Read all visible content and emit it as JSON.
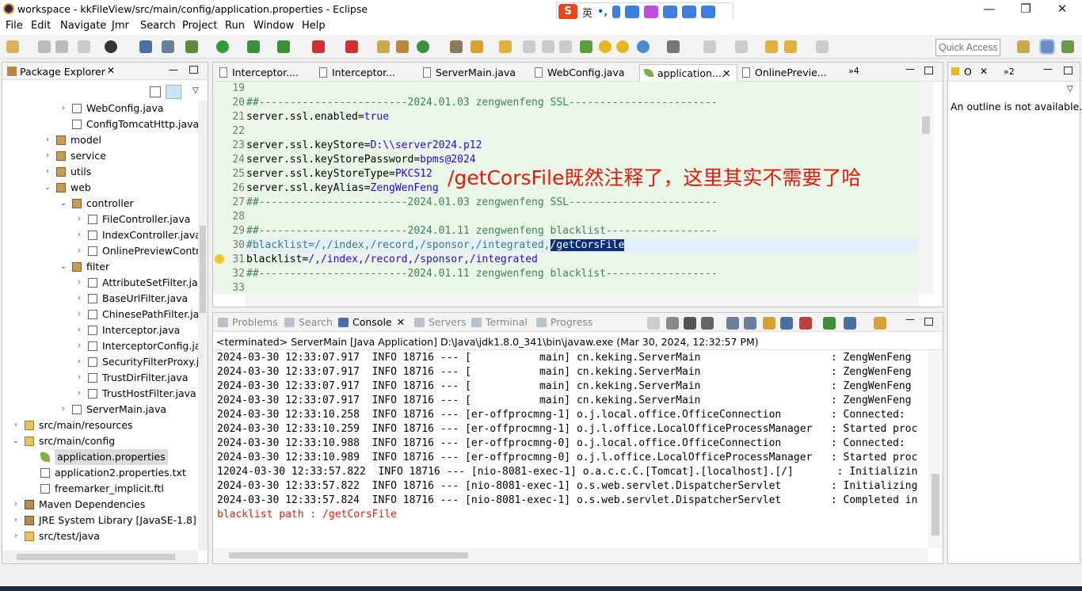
{
  "window": {
    "title": "workspace - kkFileView/src/main/config/application.properties - Eclipse",
    "min": "—",
    "restore": "❐",
    "close": "✕"
  },
  "ime": {
    "lang": "英",
    "punct": "•,",
    "logo": "S"
  },
  "menu": [
    "File",
    "Edit",
    "Navigate",
    "Jmr",
    "Search",
    "Project",
    "Run",
    "Window",
    "Help"
  ],
  "quick_access": {
    "placeholder": "Quick Access"
  },
  "package_explorer": {
    "title": "Package Explorer",
    "items": [
      {
        "label": "WebConfig.java",
        "depth": 4,
        "icon": "file",
        "tw": "›"
      },
      {
        "label": "ConfigTomcatHttp.java",
        "depth": 4,
        "icon": "file",
        "tw": ""
      },
      {
        "label": "model",
        "depth": 3,
        "icon": "pkg",
        "tw": "›"
      },
      {
        "label": "service",
        "depth": 3,
        "icon": "pkg",
        "tw": "›"
      },
      {
        "label": "utils",
        "depth": 3,
        "icon": "pkg",
        "tw": "›"
      },
      {
        "label": "web",
        "depth": 3,
        "icon": "pkg",
        "tw": "⌄"
      },
      {
        "label": "controller",
        "depth": 4,
        "icon": "pkg",
        "tw": "⌄"
      },
      {
        "label": "FileController.java",
        "depth": 5,
        "icon": "file",
        "tw": "›"
      },
      {
        "label": "IndexController.java",
        "depth": 5,
        "icon": "file",
        "tw": "›"
      },
      {
        "label": "OnlinePreviewController.java",
        "depth": 5,
        "icon": "file",
        "tw": "›"
      },
      {
        "label": "filter",
        "depth": 4,
        "icon": "pkg",
        "tw": "⌄"
      },
      {
        "label": "AttributeSetFilter.java",
        "depth": 5,
        "icon": "file",
        "tw": "›"
      },
      {
        "label": "BaseUrlFilter.java",
        "depth": 5,
        "icon": "file",
        "tw": "›"
      },
      {
        "label": "ChinesePathFilter.java",
        "depth": 5,
        "icon": "file",
        "tw": "›"
      },
      {
        "label": "Interceptor.java",
        "depth": 5,
        "icon": "file",
        "tw": "›"
      },
      {
        "label": "InterceptorConfig.java",
        "depth": 5,
        "icon": "file",
        "tw": "›"
      },
      {
        "label": "SecurityFilterProxy.java",
        "depth": 5,
        "icon": "file",
        "tw": "›"
      },
      {
        "label": "TrustDirFilter.java",
        "depth": 5,
        "icon": "file",
        "tw": "›"
      },
      {
        "label": "TrustHostFilter.java",
        "depth": 5,
        "icon": "file",
        "tw": "›"
      },
      {
        "label": "ServerMain.java",
        "depth": 4,
        "icon": "file",
        "tw": "›"
      },
      {
        "label": "src/main/resources",
        "depth": 1,
        "icon": "fold",
        "tw": "›"
      },
      {
        "label": "src/main/config",
        "depth": 1,
        "icon": "fold",
        "tw": "⌄"
      },
      {
        "label": "application.properties",
        "depth": 2,
        "icon": "leaf",
        "tw": "",
        "selected": true
      },
      {
        "label": "application2.properties.txt",
        "depth": 2,
        "icon": "file",
        "tw": ""
      },
      {
        "label": "freemarker_implicit.ftl",
        "depth": 2,
        "icon": "file",
        "tw": ""
      },
      {
        "label": "Maven Dependencies",
        "depth": 1,
        "icon": "jar",
        "tw": "›"
      },
      {
        "label": "JRE System Library [JavaSE-1.8]",
        "depth": 1,
        "icon": "jar",
        "tw": "›"
      },
      {
        "label": "src/test/java",
        "depth": 1,
        "icon": "fold",
        "tw": "›"
      }
    ]
  },
  "editor": {
    "tabs": [
      "Interceptor.java",
      "InterceptorConfig.java",
      "ServerMain.java",
      "WebConfig.java",
      "application.properties",
      "OnlinePreviewController.java"
    ],
    "tab_display": [
      "Interceptor....",
      "Interceptor...",
      "ServerMain.java",
      "WebConfig.java",
      "application....",
      "OnlinePrevie..."
    ],
    "overflow": "»4",
    "lines": [
      {
        "n": "19",
        "parts": []
      },
      {
        "n": "20",
        "parts": [
          {
            "c": "cm",
            "t": "##------------------------2024.01.03 zengwenfeng SSL------------------------"
          }
        ]
      },
      {
        "n": "21",
        "parts": [
          {
            "c": "",
            "t": "server.ssl.enabled="
          },
          {
            "c": "vb",
            "t": "true"
          }
        ]
      },
      {
        "n": "22",
        "parts": []
      },
      {
        "n": "23",
        "parts": [
          {
            "c": "",
            "t": "server.ssl.keyStore="
          },
          {
            "c": "vb",
            "t": "D:\\\\server2024.p12"
          }
        ]
      },
      {
        "n": "24",
        "parts": [
          {
            "c": "",
            "t": "server.ssl.keyStorePassword="
          },
          {
            "c": "vb",
            "t": "bpms@2024"
          }
        ]
      },
      {
        "n": "25",
        "parts": [
          {
            "c": "",
            "t": "server.ssl.keyStoreType="
          },
          {
            "c": "vb",
            "t": "PKCS12"
          }
        ]
      },
      {
        "n": "26",
        "parts": [
          {
            "c": "",
            "t": "server.ssl.keyAlias="
          },
          {
            "c": "vb",
            "t": "ZengWenFeng"
          }
        ]
      },
      {
        "n": "27",
        "parts": [
          {
            "c": "cm",
            "t": "##------------------------2024.01.03 zengwenfeng SSL------------------------"
          }
        ]
      },
      {
        "n": "28",
        "parts": []
      },
      {
        "n": "29",
        "parts": [
          {
            "c": "cm",
            "t": "##------------------------2024.01.11 zengwenfeng blacklist------------------"
          }
        ]
      },
      {
        "n": "30",
        "parts": [
          {
            "c": "cm",
            "t": "#blacklist=/,/index,/record,/sponsor,/integrated,"
          },
          {
            "c": "hl",
            "t": "/getCorsFile"
          }
        ]
      },
      {
        "n": "31",
        "parts": [
          {
            "c": "",
            "t": "blacklist="
          },
          {
            "c": "vb",
            "t": "/,/index,/record,/sponsor,/integrated"
          }
        ]
      },
      {
        "n": "32",
        "parts": [
          {
            "c": "cm",
            "t": "##------------------------2024.01.11 zengwenfeng blacklist------------------"
          }
        ]
      },
      {
        "n": "33",
        "parts": []
      }
    ]
  },
  "annotation": "/getCorsFile既然注释了，这里其实不需要了哈",
  "outline": {
    "title": "O",
    "tab2": "»2",
    "message": "An outline is not available."
  },
  "console": {
    "tabs": [
      "Problems",
      "Search",
      "Console",
      "Servers",
      "Terminal",
      "Progress"
    ],
    "header": "<terminated> ServerMain [Java Application] D:\\Java\\jdk1.8.0_341\\bin\\javaw.exe (Mar 30, 2024, 12:32:57 PM)",
    "lines": [
      "2024-03-30 12:33:07.917  INFO 18716 --- [           main] cn.keking.ServerMain                     : ZengWenFeng",
      "2024-03-30 12:33:07.917  INFO 18716 --- [           main] cn.keking.ServerMain                     : ZengWenFeng",
      "2024-03-30 12:33:07.917  INFO 18716 --- [           main] cn.keking.ServerMain                     : ZengWenFeng",
      "2024-03-30 12:33:07.917  INFO 18716 --- [           main] cn.keking.ServerMain                     : ZengWenFeng",
      "2024-03-30 12:33:10.258  INFO 18716 --- [er-offprocmng-1] o.j.local.office.OfficeConnection        : Connected:",
      "2024-03-30 12:33:10.259  INFO 18716 --- [er-offprocmng-1] o.j.l.office.LocalOfficeProcessManager   : Started proc",
      "2024-03-30 12:33:10.988  INFO 18716 --- [er-offprocmng-0] o.j.local.office.OfficeConnection        : Connected:",
      "2024-03-30 12:33:10.989  INFO 18716 --- [er-offprocmng-0] o.j.l.office.LocalOfficeProcessManager   : Started proc",
      "12024-03-30 12:33:57.822  INFO 18716 --- [nio-8081-exec-1] o.a.c.c.C.[Tomcat].[localhost].[/]       : Initializin",
      "2024-03-30 12:33:57.822  INFO 18716 --- [nio-8081-exec-1] o.s.web.servlet.DispatcherServlet        : Initializing",
      "2024-03-30 12:33:57.824  INFO 18716 --- [nio-8081-exec-1] o.s.web.servlet.DispatcherServlet        : Completed in"
    ],
    "error_line": "blacklist path : /getCorsFile"
  },
  "colors": {
    "accent": "#0a2e7a",
    "comment": "#3f7f5f",
    "value": "#2a00ff",
    "error": "#e8190b",
    "editor_bg": "#eaf7e8"
  }
}
